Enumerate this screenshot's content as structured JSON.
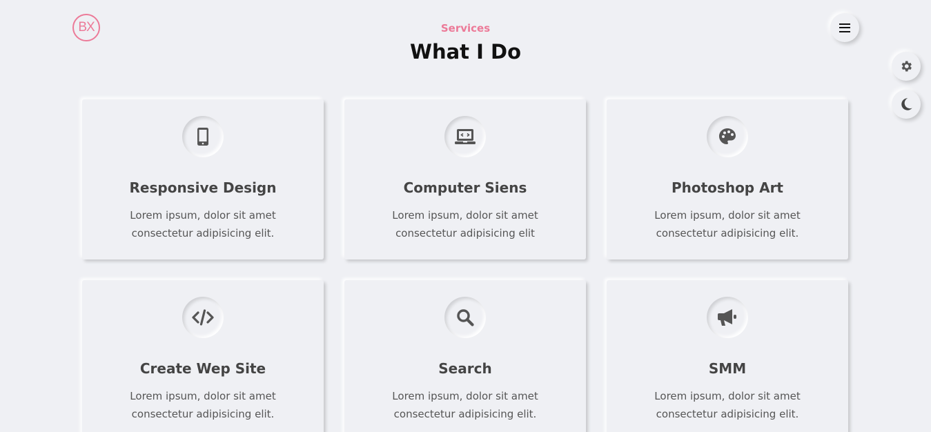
{
  "logo": {
    "text": "BX",
    "color": "#ec7a98"
  },
  "header": {
    "subtitle": "Services",
    "title": "What I Do"
  },
  "nav": {
    "menu_icon": "hamburger-icon"
  },
  "side_controls": [
    {
      "icon": "gear-icon"
    },
    {
      "icon": "moon-icon"
    }
  ],
  "colors": {
    "accent": "#ec7a98",
    "background": "#eff0f4",
    "icon": "#555555"
  },
  "services": [
    {
      "icon": "mobile-icon",
      "title": "Responsive Design",
      "text": "Lorem ipsum, dolor sit amet consectetur adipisicing elit."
    },
    {
      "icon": "laptop-code-icon",
      "title": "Computer Siens",
      "text": "Lorem ipsum, dolor sit amet consectetur adipisicing elit"
    },
    {
      "icon": "palette-icon",
      "title": "Photoshop Art",
      "text": "Lorem ipsum, dolor sit amet consectetur adipisicing elit."
    },
    {
      "icon": "code-icon",
      "title": "Create Wep Site",
      "text": "Lorem ipsum, dolor sit amet consectetur adipisicing elit."
    },
    {
      "icon": "search-icon",
      "title": "Search",
      "text": "Lorem ipsum, dolor sit amet consectetur adipisicing elit."
    },
    {
      "icon": "megaphone-icon",
      "title": "SMM",
      "text": "Lorem ipsum, dolor sit amet consectetur adipisicing elit."
    }
  ]
}
